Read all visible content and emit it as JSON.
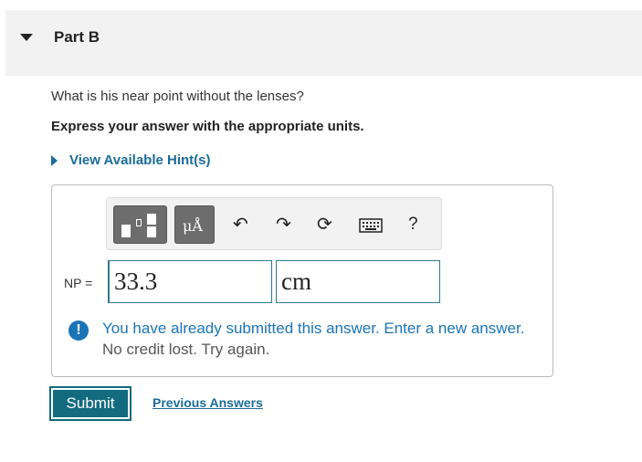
{
  "part": {
    "title": "Part B"
  },
  "question": {
    "text": "What is his near point without the lenses?",
    "instruction": "Express your answer with the appropriate units."
  },
  "hint": {
    "label": "View Available Hint(s)"
  },
  "toolbar": {
    "symbols_label": "μÅ",
    "undo_icon": "↶",
    "redo_icon": "↷",
    "reset_icon": "⟳",
    "help_label": "?"
  },
  "answer": {
    "variable_label": "NP =",
    "value": "33.3",
    "unit": "cm"
  },
  "feedback": {
    "line1": "You have already submitted this answer. Enter a new answer.",
    "line2": "No credit lost. Try again.",
    "icon": "!"
  },
  "actions": {
    "submit_label": "Submit",
    "previous_answers_label": "Previous Answers"
  },
  "colors": {
    "accent": "#136b7f",
    "link": "#1a6c9a",
    "alert": "#1a74b8"
  }
}
